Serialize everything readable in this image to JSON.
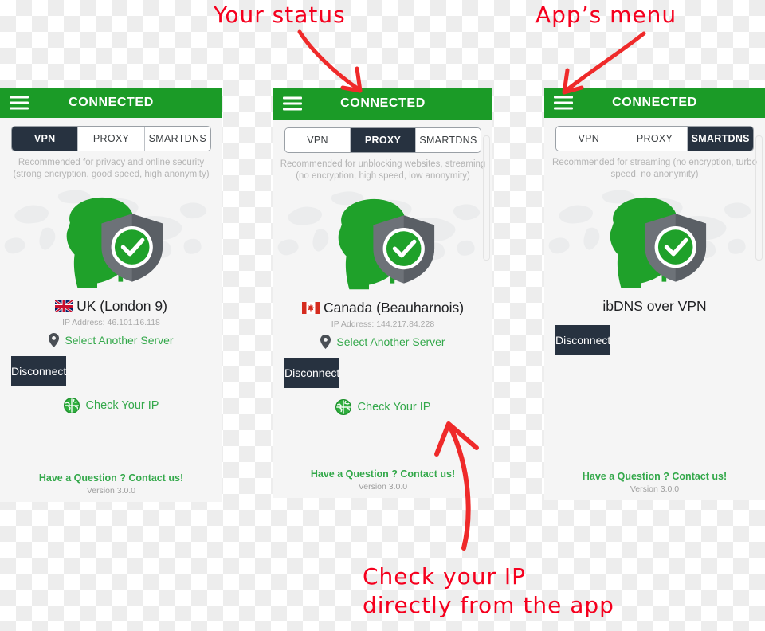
{
  "colors": {
    "header_green": "#1b9b27",
    "accent_green": "#33a84a",
    "logo_green": "#1fa12a",
    "dark_button": "#273240",
    "panel_bg": "#f5f5f5",
    "muted_text": "#b4b4b4",
    "annotation_red": "#f5001e"
  },
  "annotations": {
    "status": "Your status",
    "menu": "App’s menu",
    "check_ip_line1": "Check your IP",
    "check_ip_line2": "directly from the app"
  },
  "screens": [
    {
      "id": "vpn-screen",
      "menu_icon": "hamburger-menu-icon",
      "title": "CONNECTED",
      "tabs": [
        {
          "label": "VPN",
          "active": true
        },
        {
          "label": "PROXY",
          "active": false
        },
        {
          "label": "SMARTDNS",
          "active": false
        }
      ],
      "description": "Recommended for privacy and online security\n(strong encryption, good speed, high anonymity)",
      "logo_icon": "detective-shield-check-icon",
      "flag_icon": "uk-flag-icon",
      "location": "UK (London 9)",
      "ip_address": "IP Address: 46.101.16.118",
      "select_server_icon": "location-pin-icon",
      "select_server_label": "Select Another Server",
      "disconnect_label": "Disconnect",
      "check_ip_icon": "globe-icon",
      "check_ip_label": "Check Your IP",
      "contact_label": "Have a Question ? Contact us!",
      "version": "Version 3.0.0",
      "has_scrollbar": false,
      "show_location_block": true
    },
    {
      "id": "proxy-screen",
      "menu_icon": "hamburger-menu-icon",
      "title": "CONNECTED",
      "tabs": [
        {
          "label": "VPN",
          "active": false
        },
        {
          "label": "PROXY",
          "active": true
        },
        {
          "label": "SMARTDNS",
          "active": false
        }
      ],
      "description": "Recommended for unblocking websites, streaming\n(no encryption, high speed, low anonymity)",
      "logo_icon": "detective-shield-check-icon",
      "flag_icon": "canada-flag-icon",
      "location": "Canada (Beauharnois)",
      "ip_address": "IP Address: 144.217.84.228",
      "select_server_icon": "location-pin-icon",
      "select_server_label": "Select Another Server",
      "disconnect_label": "Disconnect",
      "check_ip_icon": "globe-icon",
      "check_ip_label": "Check Your IP",
      "contact_label": "Have a Question ? Contact us!",
      "version": "Version 3.0.0",
      "has_scrollbar": true,
      "show_location_block": true
    },
    {
      "id": "smartdns-screen",
      "menu_icon": "hamburger-menu-icon",
      "title": "CONNECTED",
      "tabs": [
        {
          "label": "VPN",
          "active": false
        },
        {
          "label": "PROXY",
          "active": false
        },
        {
          "label": "SMARTDNS",
          "active": true
        }
      ],
      "description": "Recommended for streaming (no encryption, turbo\nspeed, no anonymity)",
      "logo_icon": "detective-shield-check-icon",
      "flag_icon": null,
      "location": "ibDNS over VPN",
      "ip_address": null,
      "select_server_icon": null,
      "select_server_label": null,
      "disconnect_label": "Disconnect",
      "check_ip_icon": null,
      "check_ip_label": null,
      "contact_label": "Have a Question ? Contact us!",
      "version": "Version 3.0.0",
      "has_scrollbar": true,
      "show_location_block": false
    }
  ]
}
